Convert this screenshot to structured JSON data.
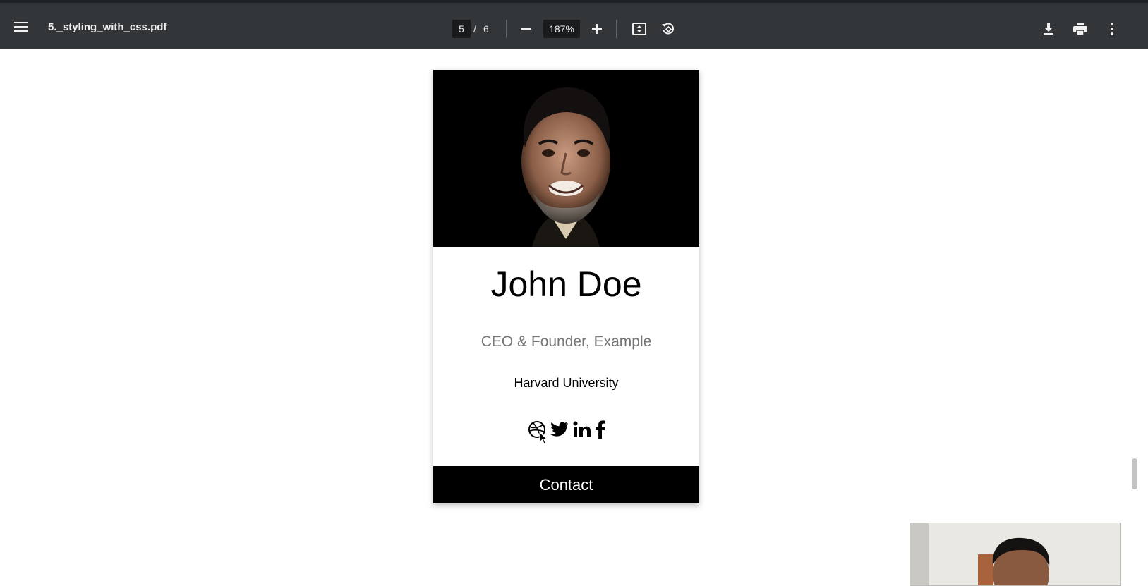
{
  "toolbar": {
    "file_name": "5._styling_with_css.pdf",
    "current_page": "5",
    "page_separator": "/",
    "total_pages": "6",
    "zoom": "187%",
    "icons": [
      "menu-icon",
      "zoom-out-icon",
      "zoom-in-icon",
      "fit-to-page-icon",
      "rotate-icon",
      "download-icon",
      "print-icon",
      "more-vert-icon"
    ]
  },
  "card": {
    "name": "John Doe",
    "title": "CEO & Founder, Example",
    "school": "Harvard University",
    "socials": [
      "dribbble-icon",
      "twitter-icon",
      "linkedin-icon",
      "facebook-icon"
    ],
    "contact_label": "Contact"
  },
  "colors": {
    "toolbar_bg": "#323639",
    "card_photo_bg": "#000000",
    "contact_bg": "#000000",
    "title_text": "#757575"
  }
}
